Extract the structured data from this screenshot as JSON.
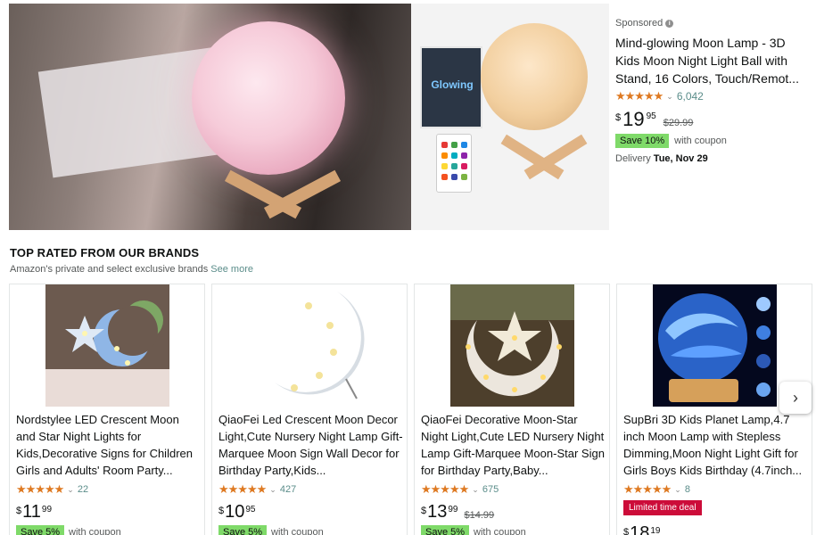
{
  "banner": {
    "box_text": "Glowing",
    "sponsored": "Sponsored",
    "info_icon": "i",
    "title": "Mind-glowing Moon Lamp - 3D Kids Moon Night Light Ball with Stand, 16 Colors, Touch/Remot...",
    "stars": "★★★★★",
    "rating_count": "6,042",
    "price_symbol": "$",
    "price_whole": "19",
    "price_fraction": "95",
    "list_price": "$29.99",
    "save_badge": "Save 10%",
    "coupon_text": "with coupon",
    "delivery_label": "Delivery",
    "delivery_date": "Tue, Nov 29"
  },
  "section": {
    "title": "TOP RATED FROM OUR BRANDS",
    "subtitle": "Amazon's private and select exclusive brands",
    "see_more": "See more"
  },
  "cards": [
    {
      "title": "Nordstylee LED Crescent Moon and Star Night Lights for Kids,Decorative Signs for Children Girls and Adults' Room Party...",
      "stars": "★★★★★",
      "rating_count": "22",
      "price_symbol": "$",
      "price_whole": "11",
      "price_fraction": "99",
      "save_badge": "Save 5%",
      "coupon_text": "with coupon"
    },
    {
      "title": "QiaoFei Led Crescent Moon Decor Light,Cute Nursery Night Lamp Gift-Marquee Moon Sign Wall Decor for Birthday Party,Kids...",
      "stars": "★★★★★",
      "rating_count": "427",
      "price_symbol": "$",
      "price_whole": "10",
      "price_fraction": "95",
      "save_badge": "Save 5%",
      "coupon_text": "with coupon"
    },
    {
      "title": "QiaoFei Decorative Moon-Star Night Light,Cute LED Nursery Night Lamp Gift-Marquee Moon-Star Sign for Birthday Party,Baby...",
      "stars": "★★★★★",
      "rating_count": "675",
      "price_symbol": "$",
      "price_whole": "13",
      "price_fraction": "99",
      "list_price": "$14.99",
      "save_badge": "Save 5%",
      "coupon_text": "with coupon"
    },
    {
      "title": "SupBri 3D Kids Planet Lamp,4.7 inch Moon Lamp with Stepless Dimming,Moon Night Light Gift for Girls Boys Kids Birthday (4.7inch...",
      "stars": "★★★★★",
      "rating_count": "8",
      "deal_badge": "Limited time deal",
      "price_symbol": "$",
      "price_whole": "18",
      "price_fraction": "19"
    }
  ],
  "next_icon": "chevron-right-icon",
  "colors": {
    "star": "#de7921",
    "link": "#5b8d8a",
    "save_badge": "#7fda69",
    "deal_badge": "#cc0c39"
  }
}
